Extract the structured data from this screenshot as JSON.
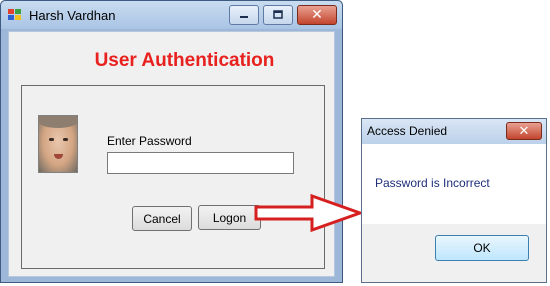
{
  "main_window": {
    "title": "Harsh Vardhan",
    "heading": "User Authentication",
    "password_label": "Enter Password",
    "password_value": "",
    "cancel_label": "Cancel",
    "logon_label": "Logon",
    "heading_color": "#e8211f"
  },
  "dialog": {
    "title": "Access Denied",
    "message": "Password is Incorrect",
    "ok_label": "OK"
  },
  "icons": {
    "app": "app-window-icon",
    "minimize": "minimize-icon",
    "maximize": "maximize-icon",
    "close": "close-icon",
    "arrow": "right-arrow-icon"
  },
  "colors": {
    "arrow": "#d62020",
    "close_button": "#c2452d"
  }
}
